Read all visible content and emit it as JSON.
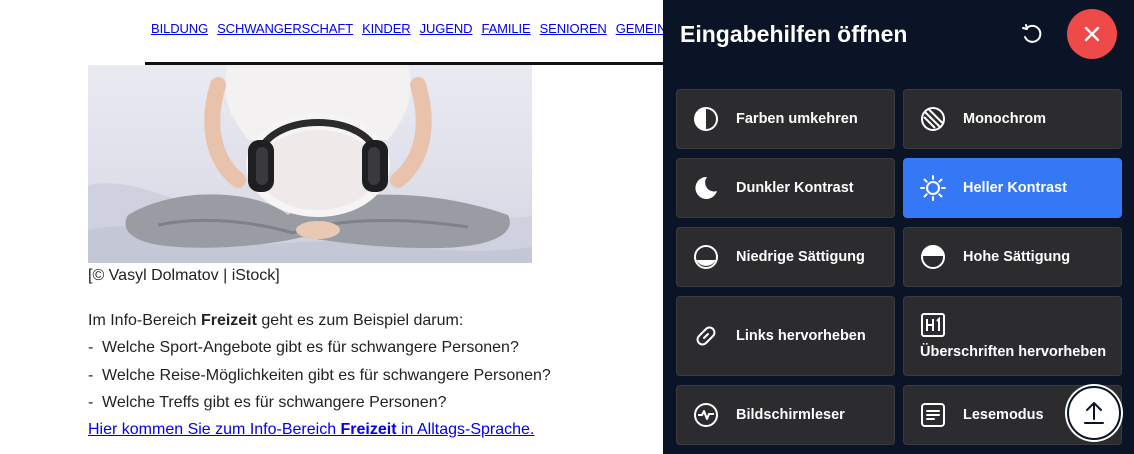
{
  "nav": {
    "items": [
      "BILDUNG",
      "SCHWANGERSCHAFT",
      "KINDER",
      "JUGEND",
      "FAMILIE",
      "SENIOREN",
      "GEMEINSCH"
    ]
  },
  "article": {
    "caption": "[© Vasyl Dolmatov | iStock]",
    "intro_prefix": "Im Info-Bereich ",
    "intro_bold": "Freizeit",
    "intro_suffix": " geht es zum Beispiel darum:",
    "bullet_dash": "-",
    "bullets": [
      "Welche Sport-Angebote gibt es für schwangere Personen?",
      "Welche Reise-Möglichkeiten gibt es für schwangere Personen?",
      "Welche Treffs gibt es für schwangere Personen?"
    ],
    "link_prefix": "Hier kommen Sie zum Info-Bereich ",
    "link_bold": "Freizeit",
    "link_suffix": " in Alltags-Sprache."
  },
  "panel": {
    "title": "Eingabehilfen öffnen",
    "reset_icon": "reset-icon",
    "close_icon": "close-icon",
    "tiles": [
      {
        "label": "Farben umkehren",
        "icon": "invert-colors-icon",
        "active": false
      },
      {
        "label": "Monochrom",
        "icon": "monochrome-icon",
        "active": false
      },
      {
        "label": "Dunkler Kontrast",
        "icon": "moon-icon",
        "active": false
      },
      {
        "label": "Heller Kontrast",
        "icon": "sun-icon",
        "active": true
      },
      {
        "label": "Niedrige Sättigung",
        "icon": "low-saturation-icon",
        "active": false
      },
      {
        "label": "Hohe Sättigung",
        "icon": "high-saturation-icon",
        "active": false
      },
      {
        "label": "Links hervorheben",
        "icon": "link-icon",
        "active": false
      },
      {
        "label": "Überschriften hervorheben",
        "icon": "h1-icon",
        "active": false
      },
      {
        "label": "Bildschirmleser",
        "icon": "heartbeat-icon",
        "active": false
      },
      {
        "label": "Lesemodus",
        "icon": "reading-mode-icon",
        "active": false
      }
    ],
    "scroll_top_icon": "arrow-up-icon"
  },
  "colors": {
    "panel_bg": "#0b1427",
    "tile_bg": "#2c2c2e",
    "active_tile": "#3478f6",
    "close_button": "#ee4a4a",
    "link": "#0000ee"
  }
}
